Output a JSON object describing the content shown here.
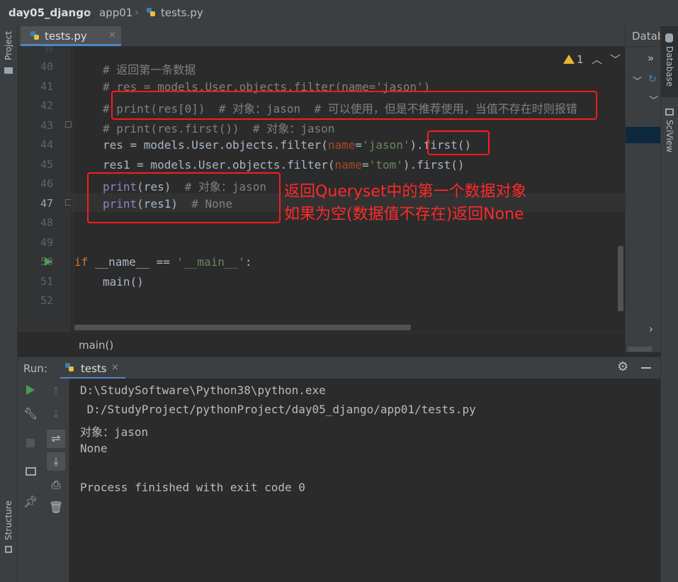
{
  "breadcrumb": {
    "project": "day05_django",
    "folder": "app01",
    "file": "tests.py"
  },
  "left_strip": {
    "project_label": "Project",
    "structure_label": "Structure"
  },
  "tabs": [
    {
      "label": "tests.py",
      "close": "×"
    }
  ],
  "inspections": {
    "warning_count": "1"
  },
  "right_panel": {
    "title": "Datab",
    "arrows": "»"
  },
  "right_strip": {
    "database_label": "Database",
    "sciview_label": "SciView"
  },
  "editor": {
    "line_numbers": [
      "40",
      "41",
      "42",
      "43",
      "44",
      "45",
      "46",
      "47",
      "48",
      "49",
      "50",
      "51",
      "52"
    ],
    "lines": {
      "l40": "# 返回第一条数据",
      "l41": "# res = models.User.objects.filter(name='jason')",
      "l42": "# print(res[0])  # 对象：jason  # 可以使用，但是不推荐使用，当值不存在时则报错",
      "l43": "# print(res.first())  # 对象：jason",
      "l44_a": "res = models.User.objects.filter(",
      "l44_b": "name",
      "l44_c": "=",
      "l44_d": "'jason'",
      "l44_e": ").first()",
      "l45_a": "res1 = models.User.objects.filter(",
      "l45_b": "name",
      "l45_c": "=",
      "l45_d": "'tom'",
      "l45_e": ").first()",
      "l46_a": "print",
      "l46_b": "(res)  ",
      "l46_c": "# 对象：jason",
      "l47_a": "print",
      "l47_b": "(res1)  ",
      "l47_c": "# None",
      "l50_a": "if ",
      "l50_b": "__name__ == ",
      "l50_c": "'__main__'",
      "l50_d": ":",
      "l51": "main()"
    },
    "annotation_line1": "返回Queryset中的第一个数据对象",
    "annotation_line2": "如果为空(数据值不存在)返回None"
  },
  "function_crumb": "main()",
  "run": {
    "label": "Run:",
    "tab": "tests",
    "close": "×",
    "output": [
      "D:\\StudySoftware\\Python38\\python.exe",
      " D:/StudyProject/pythonProject/day05_django/app01/tests.py",
      "对象：jason",
      "None",
      "",
      "Process finished with exit code 0"
    ]
  },
  "colors": {
    "accent": "#4a88c7",
    "annotation_red": "#ff1a1a",
    "run_green": "#499c54"
  }
}
